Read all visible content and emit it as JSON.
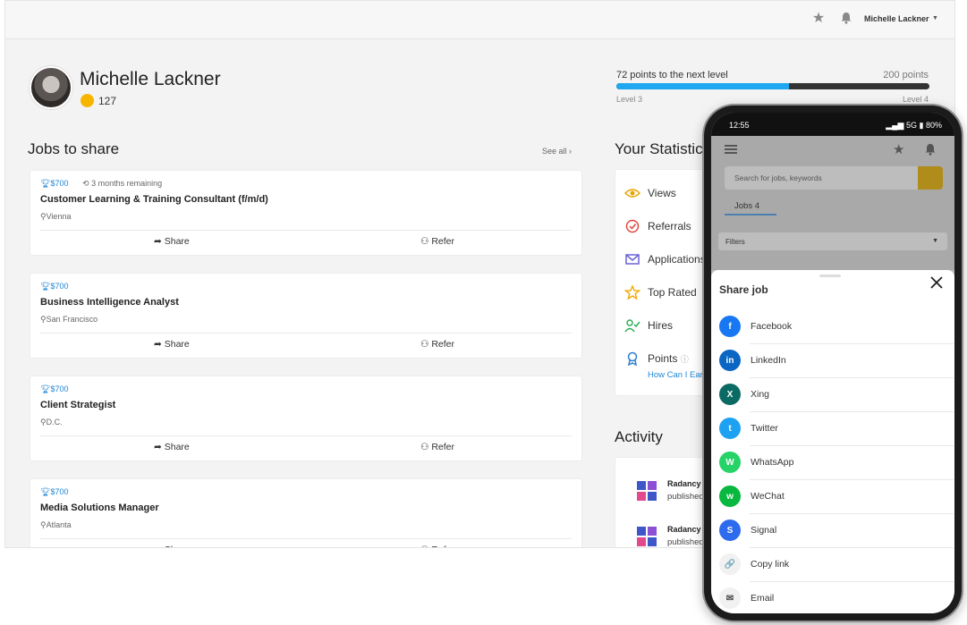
{
  "header": {
    "user_name": "Michelle Lackner"
  },
  "profile": {
    "name": "Michelle Lackner",
    "points": "127"
  },
  "level": {
    "to_next": "72 points to the next level",
    "total": "200 points",
    "from": "Level 3",
    "to": "Level 4",
    "progress_fraction": 0.55,
    "accent": "#1fa8ef"
  },
  "jobs": {
    "title": "Jobs to share",
    "see_all": "See all",
    "share_label": "Share",
    "refer_label": "Refer",
    "items": [
      {
        "reward": "$700",
        "remaining": "3 months remaining",
        "title": "Customer Learning & Training Consultant (f/m/d)",
        "location": "Vienna"
      },
      {
        "reward": "$700",
        "remaining": "",
        "title": "Business Intelligence Analyst",
        "location": "San Francisco"
      },
      {
        "reward": "$700",
        "remaining": "",
        "title": "Client Strategist",
        "location": "D.C."
      },
      {
        "reward": "$700",
        "remaining": "",
        "title": "Media Solutions Manager",
        "location": "Atlanta"
      }
    ]
  },
  "stats": {
    "title": "Your Statistic",
    "items": [
      "Views",
      "Referrals",
      "Applications",
      "Top Rated",
      "Hires",
      "Points"
    ],
    "how_earn": "How Can I Earn"
  },
  "activity": {
    "title": "Activity",
    "items": [
      {
        "name": "Radancy",
        "text": "published"
      },
      {
        "name": "Radancy",
        "text": "published"
      }
    ]
  },
  "phone": {
    "time": "12:55",
    "network": "5G",
    "battery": "80%",
    "search_placeholder": "Search for jobs, keywords",
    "tab": "Jobs 4",
    "filters": "Filters",
    "sheet_title": "Share job",
    "options": [
      {
        "label": "Facebook",
        "icon": "facebook-icon",
        "color": "#1877f2",
        "glyph": "f"
      },
      {
        "label": "LinkedIn",
        "icon": "linkedin-icon",
        "color": "#0a66c2",
        "glyph": "in"
      },
      {
        "label": "Xing",
        "icon": "xing-icon",
        "color": "#0b6b64",
        "glyph": "X"
      },
      {
        "label": "Twitter",
        "icon": "twitter-icon",
        "color": "#1da1f2",
        "glyph": "t"
      },
      {
        "label": "WhatsApp",
        "icon": "whatsapp-icon",
        "color": "#25d366",
        "glyph": "W"
      },
      {
        "label": "WeChat",
        "icon": "wechat-icon",
        "color": "#09b83e",
        "glyph": "w"
      },
      {
        "label": "Signal",
        "icon": "signal-icon",
        "color": "#2c6bed",
        "glyph": "S"
      },
      {
        "label": "Copy link",
        "icon": "link-icon",
        "color": "#f1f1f1",
        "glyph": "🔗"
      },
      {
        "label": "Email",
        "icon": "email-icon",
        "color": "#f1f1f1",
        "glyph": "✉"
      }
    ]
  }
}
